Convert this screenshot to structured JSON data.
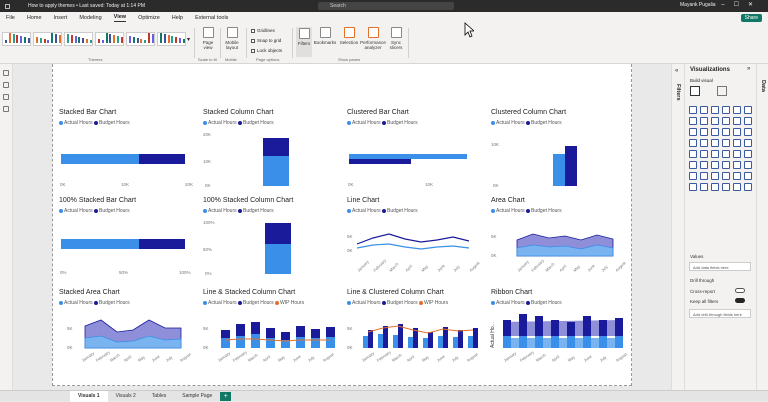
{
  "titlebar": {
    "title": "How to apply themes • Last saved: Today at 1:14 PM",
    "search": "Search",
    "user": "Mayank Pugalia"
  },
  "menu": [
    "File",
    "Home",
    "Insert",
    "Modeling",
    "View",
    "Optimize",
    "Help",
    "External tools"
  ],
  "share": "Share",
  "ribbon": {
    "themes_label": "Themes",
    "page_view": "Page view",
    "scale_label": "Scale to fit",
    "mobile_layout": "Mobile layout",
    "mobile_label": "Mobile",
    "options": [
      "Gridlines",
      "Snap to grid",
      "Lock objects"
    ],
    "options_label": "Page options",
    "panes": [
      "Filters",
      "Bookmarks",
      "Selection",
      "Performance analyzer",
      "Sync slicers"
    ],
    "panes_label": "Show panes"
  },
  "colors": {
    "actual": "#3a8fe8",
    "budget": "#1a1b9a",
    "wip": "#e3702a",
    "accent": "#117865"
  },
  "legend": {
    "actual": "Actual Hours",
    "budget": "Budget Hours",
    "wip": "WIP Hours"
  },
  "charts": {
    "c1": {
      "title": "Stacked Bar Chart",
      "ticks": [
        "0K",
        "10K",
        "20K"
      ]
    },
    "c2": {
      "title": "Stacked Column Chart",
      "ticks": [
        "20K",
        "10K",
        "0K"
      ]
    },
    "c3": {
      "title": "Clustered Bar Chart",
      "ticks": [
        "0K",
        "10K"
      ]
    },
    "c4": {
      "title": "Clustered Column Chart",
      "ticks": [
        "10K",
        "0K"
      ]
    },
    "c5": {
      "title": "100% Stacked Bar Chart",
      "ticks": [
        "0%",
        "50%",
        "100%"
      ]
    },
    "c6": {
      "title": "100% Stacked Column Chart",
      "ticks": [
        "100%",
        "50%",
        "0%"
      ]
    },
    "c7": {
      "title": "Line Chart",
      "ticks": [
        "5K",
        "0K"
      ]
    },
    "c8": {
      "title": "Area Chart",
      "ticks": [
        "5K",
        "0K"
      ]
    },
    "c9": {
      "title": "Stacked Area Chart",
      "ticks": [
        "5K",
        "0K"
      ]
    },
    "c10": {
      "title": "Line & Stacked Column Chart",
      "ticks": [
        "5K",
        "0K"
      ]
    },
    "c11": {
      "title": "Line & Clustered Column Chart",
      "ticks": [
        "5K",
        "0K"
      ]
    },
    "c12": {
      "title": "Ribbon Chart",
      "yaxis": "Actual Ho..."
    }
  },
  "months": [
    "January",
    "February",
    "March",
    "April",
    "May",
    "June",
    "July",
    "August"
  ],
  "viz": {
    "title": "Visualizations",
    "build": "Build visual",
    "values": "Values",
    "add_fields": "Add data fields here",
    "drill": "Drill through",
    "cross": "Cross-report",
    "keep": "Keep all filters",
    "add_drill": "Add drill-through fields here"
  },
  "filters_label": "Filters",
  "data_label": "Data",
  "tabs": [
    "Visuals 1",
    "Visuals 2",
    "Tables",
    "Sample Page"
  ]
}
